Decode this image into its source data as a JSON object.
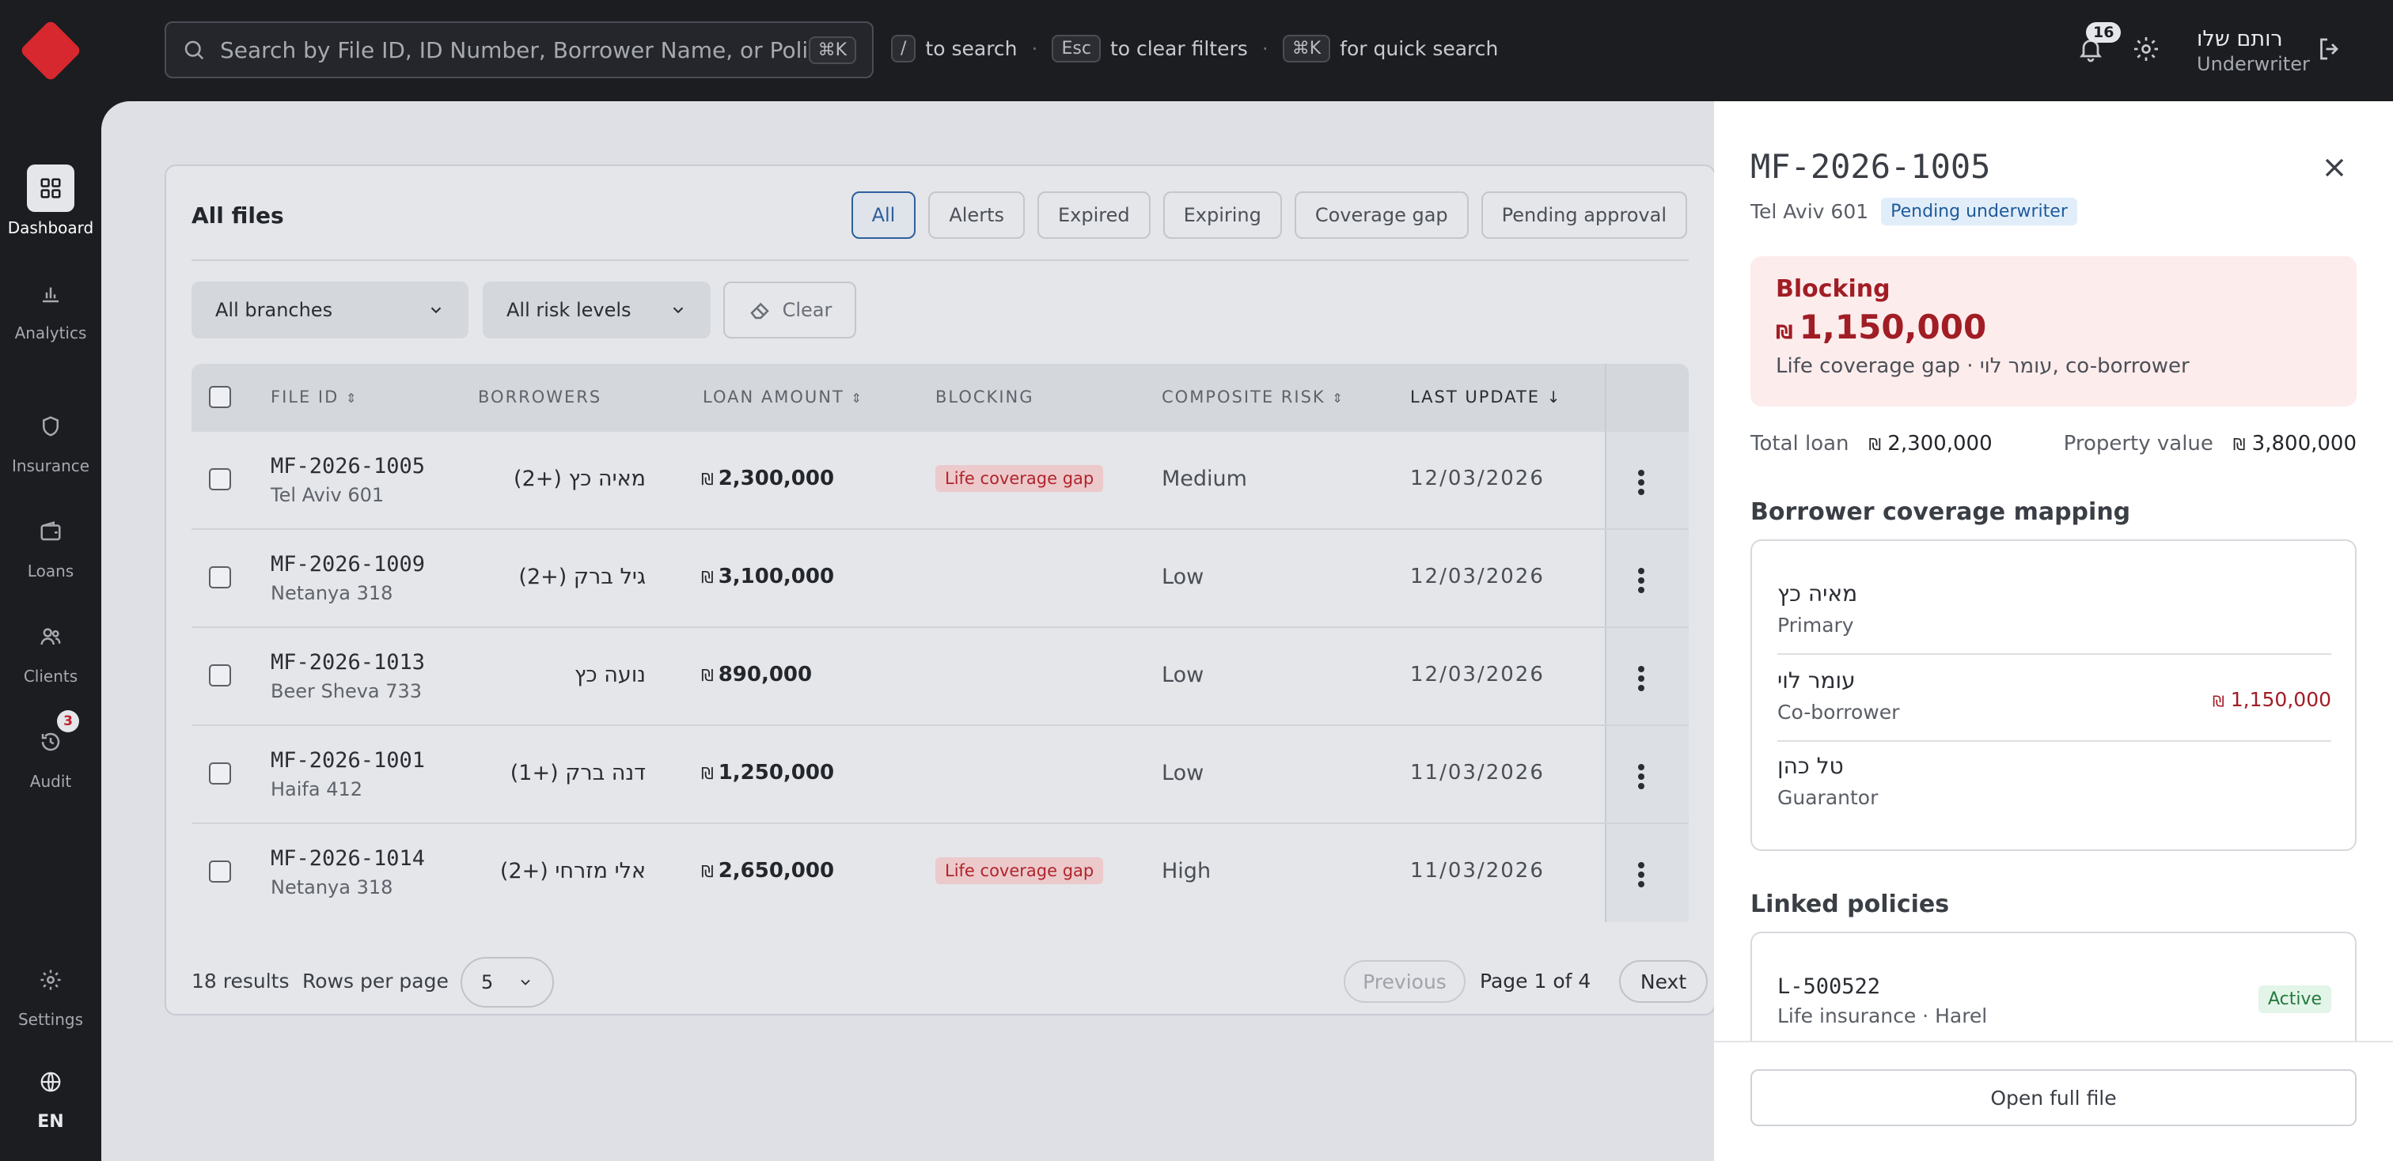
{
  "header": {
    "search_placeholder": "Search by File ID, ID Number, Borrower Name, or Policy...",
    "search_kbd": "⌘K",
    "hints": [
      {
        "key": "/",
        "text": "to search"
      },
      {
        "key": "Esc",
        "text": "to clear filters"
      },
      {
        "key": "⌘K",
        "text": "for quick search"
      }
    ],
    "notifications_count": "16",
    "user_name": "רותם שלו",
    "user_role": "Underwriter"
  },
  "sidebar": {
    "items": [
      {
        "label": "Dashboard",
        "icon": "grid-icon",
        "active": true
      },
      {
        "label": "Analytics",
        "icon": "bar-chart-icon"
      },
      {
        "label": "Insurance",
        "icon": "shield-icon"
      },
      {
        "label": "Loans",
        "icon": "wallet-icon"
      },
      {
        "label": "Clients",
        "icon": "users-icon"
      },
      {
        "label": "Audit",
        "icon": "history-icon",
        "badge": "3"
      },
      {
        "label": "Settings",
        "icon": "gear-icon"
      }
    ],
    "language": "EN"
  },
  "files": {
    "title": "All files",
    "filters": [
      "All",
      "Alerts",
      "Expired",
      "Expiring",
      "Coverage gap",
      "Pending approval"
    ],
    "active_filter": "All",
    "branch_select": "All branches",
    "risk_select": "All risk levels",
    "clear_label": "Clear",
    "columns": [
      "FILE ID",
      "BORROWERS",
      "LOAN AMOUNT",
      "BLOCKING",
      "COMPOSITE RISK",
      "LAST UPDATE"
    ],
    "currency": "₪",
    "rows": [
      {
        "id": "MF-2026-1005",
        "location": "Tel Aviv 601",
        "borrowers": "מאיה כץ (+2)",
        "amount": "2,300,000",
        "blocking": "Life coverage gap",
        "risk": "Medium",
        "updated": "12/03/2026"
      },
      {
        "id": "MF-2026-1009",
        "location": "Netanya 318",
        "borrowers": "גיל ברק (+2)",
        "amount": "3,100,000",
        "blocking": "",
        "risk": "Low",
        "updated": "12/03/2026"
      },
      {
        "id": "MF-2026-1013",
        "location": "Beer Sheva 733",
        "borrowers": "נועה כץ",
        "amount": "890,000",
        "blocking": "",
        "risk": "Low",
        "updated": "12/03/2026"
      },
      {
        "id": "MF-2026-1001",
        "location": "Haifa 412",
        "borrowers": "דנה ברק (+1)",
        "amount": "1,250,000",
        "blocking": "",
        "risk": "Low",
        "updated": "11/03/2026"
      },
      {
        "id": "MF-2026-1014",
        "location": "Netanya 318",
        "borrowers": "אלי מזרחי (+2)",
        "amount": "2,650,000",
        "blocking": "Life coverage gap",
        "risk": "High",
        "updated": "11/03/2026"
      }
    ],
    "results": "18 results",
    "rows_per_page_label": "Rows per page",
    "rows_per_page": "5",
    "prev_label": "Previous",
    "page_info": "Page 1 of 4",
    "next_label": "Next"
  },
  "drawer": {
    "file_id": "MF-2026-1005",
    "location": "Tel Aviv 601",
    "status": "Pending underwriter",
    "blocking_title": "Blocking",
    "blocking_amount": "1,150,000",
    "blocking_desc": "Life coverage gap · עומר לוי, co-borrower",
    "total_loan_label": "Total loan",
    "total_loan": "2,300,000",
    "property_value_label": "Property value",
    "property_value": "3,800,000",
    "mapping_title": "Borrower coverage mapping",
    "mapping": [
      {
        "name": "מאיה כץ",
        "role": "Primary",
        "gap": ""
      },
      {
        "name": "עומר לוי",
        "role": "Co-borrower",
        "gap": "1,150,000"
      },
      {
        "name": "טל כהן",
        "role": "Guarantor",
        "gap": ""
      }
    ],
    "policies_title": "Linked policies",
    "policy": {
      "id": "L-500522",
      "desc": "Life insurance · Harel",
      "status": "Active"
    },
    "open_label": "Open full file"
  },
  "colors": {
    "brand": "#d6282e",
    "accent": "#2e5f9c",
    "danger": "#a11d25",
    "success": "#237a3f"
  }
}
